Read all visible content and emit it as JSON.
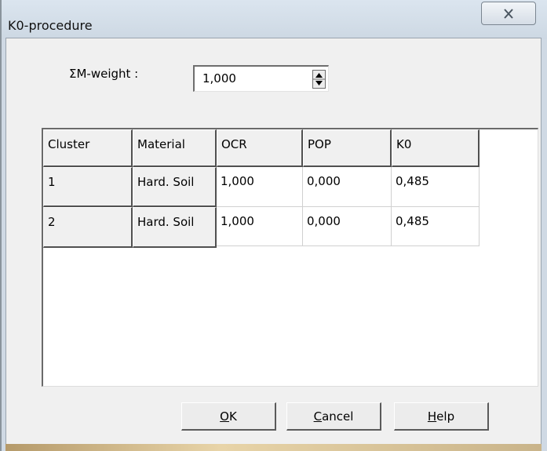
{
  "window": {
    "title": "K0-procedure",
    "close_icon": "close-x-icon"
  },
  "weight": {
    "label": "ΣM-weight :",
    "value": "1,000",
    "spin_icon": "spin-up-down-icon"
  },
  "table": {
    "columns": [
      "Cluster",
      "Material",
      "OCR",
      "POP",
      "K0"
    ],
    "rows": [
      {
        "cluster": "1",
        "material": "Hard. Soil",
        "ocr": "1,000",
        "pop": "0,000",
        "k0": "0,485"
      },
      {
        "cluster": "2",
        "material": "Hard. Soil",
        "ocr": "1,000",
        "pop": "0,000",
        "k0": "0,485"
      }
    ]
  },
  "buttons": {
    "ok": {
      "accel": "O",
      "rest": "K"
    },
    "cancel": {
      "accel": "C",
      "rest": "ancel"
    },
    "help": {
      "accel": "H",
      "rest": "elp"
    }
  }
}
